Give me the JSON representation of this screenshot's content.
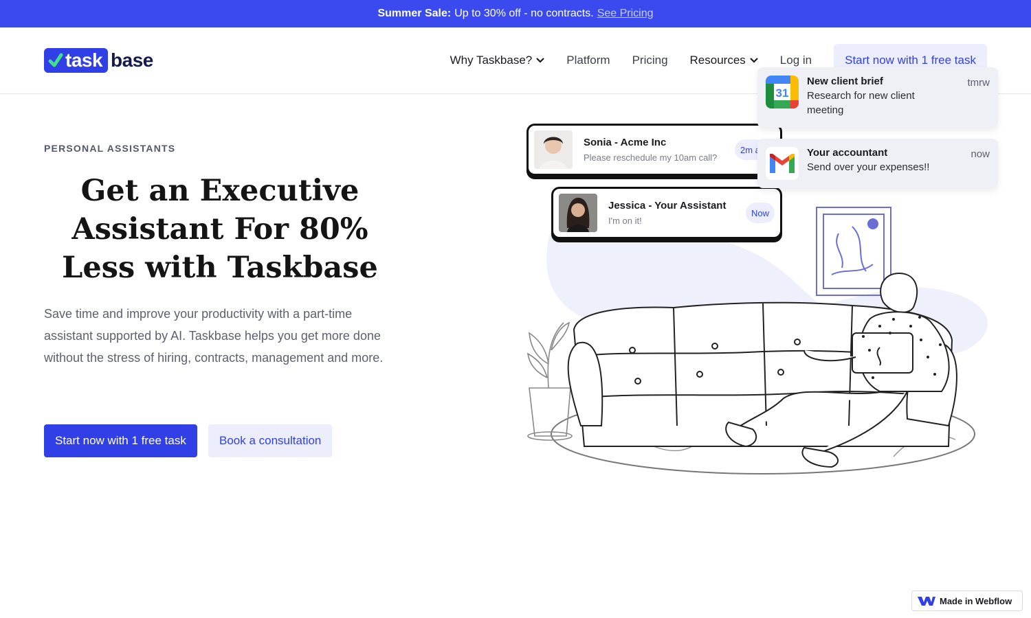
{
  "promo": {
    "strong": "Summer Sale:",
    "text": "Up to 30% off - no contracts.",
    "link": "See Pricing"
  },
  "brand": {
    "part1": "task",
    "part2": "base",
    "accent": "#3140e6"
  },
  "nav": {
    "items": [
      "Why Taskbase?",
      "Platform",
      "Pricing",
      "Resources",
      "Log in"
    ],
    "cta": "Start now with 1 free task"
  },
  "hero": {
    "eyebrow": "PERSONAL ASSISTANTS",
    "title": "Get an Executive Assistant For 80% Less with Taskbase",
    "copy": "Save time and improve your productivity with a part-time assistant supported by AI. Taskbase helps you get more done without the stress of hiring, contracts, management and more.",
    "primary": "Start now with 1 free task",
    "secondary": "Book a consultation"
  },
  "chats": [
    {
      "name": "Sonia - Acme Inc",
      "message": "Please reschedule my 10am call?",
      "time": "2m a"
    },
    {
      "name": "Jessica - Your Assistant",
      "message": "I'm on it!",
      "time": "Now"
    }
  ],
  "notifications": [
    {
      "title": "New client brief",
      "body": "Research for new client meeting",
      "time": "tmrw",
      "icon": "google-calendar-icon",
      "icon_text": "31"
    },
    {
      "title": "Your accountant",
      "body": "Send over your expenses!!",
      "time": "now",
      "icon": "gmail-icon"
    }
  ],
  "badge": {
    "label": "Made in Webflow"
  }
}
